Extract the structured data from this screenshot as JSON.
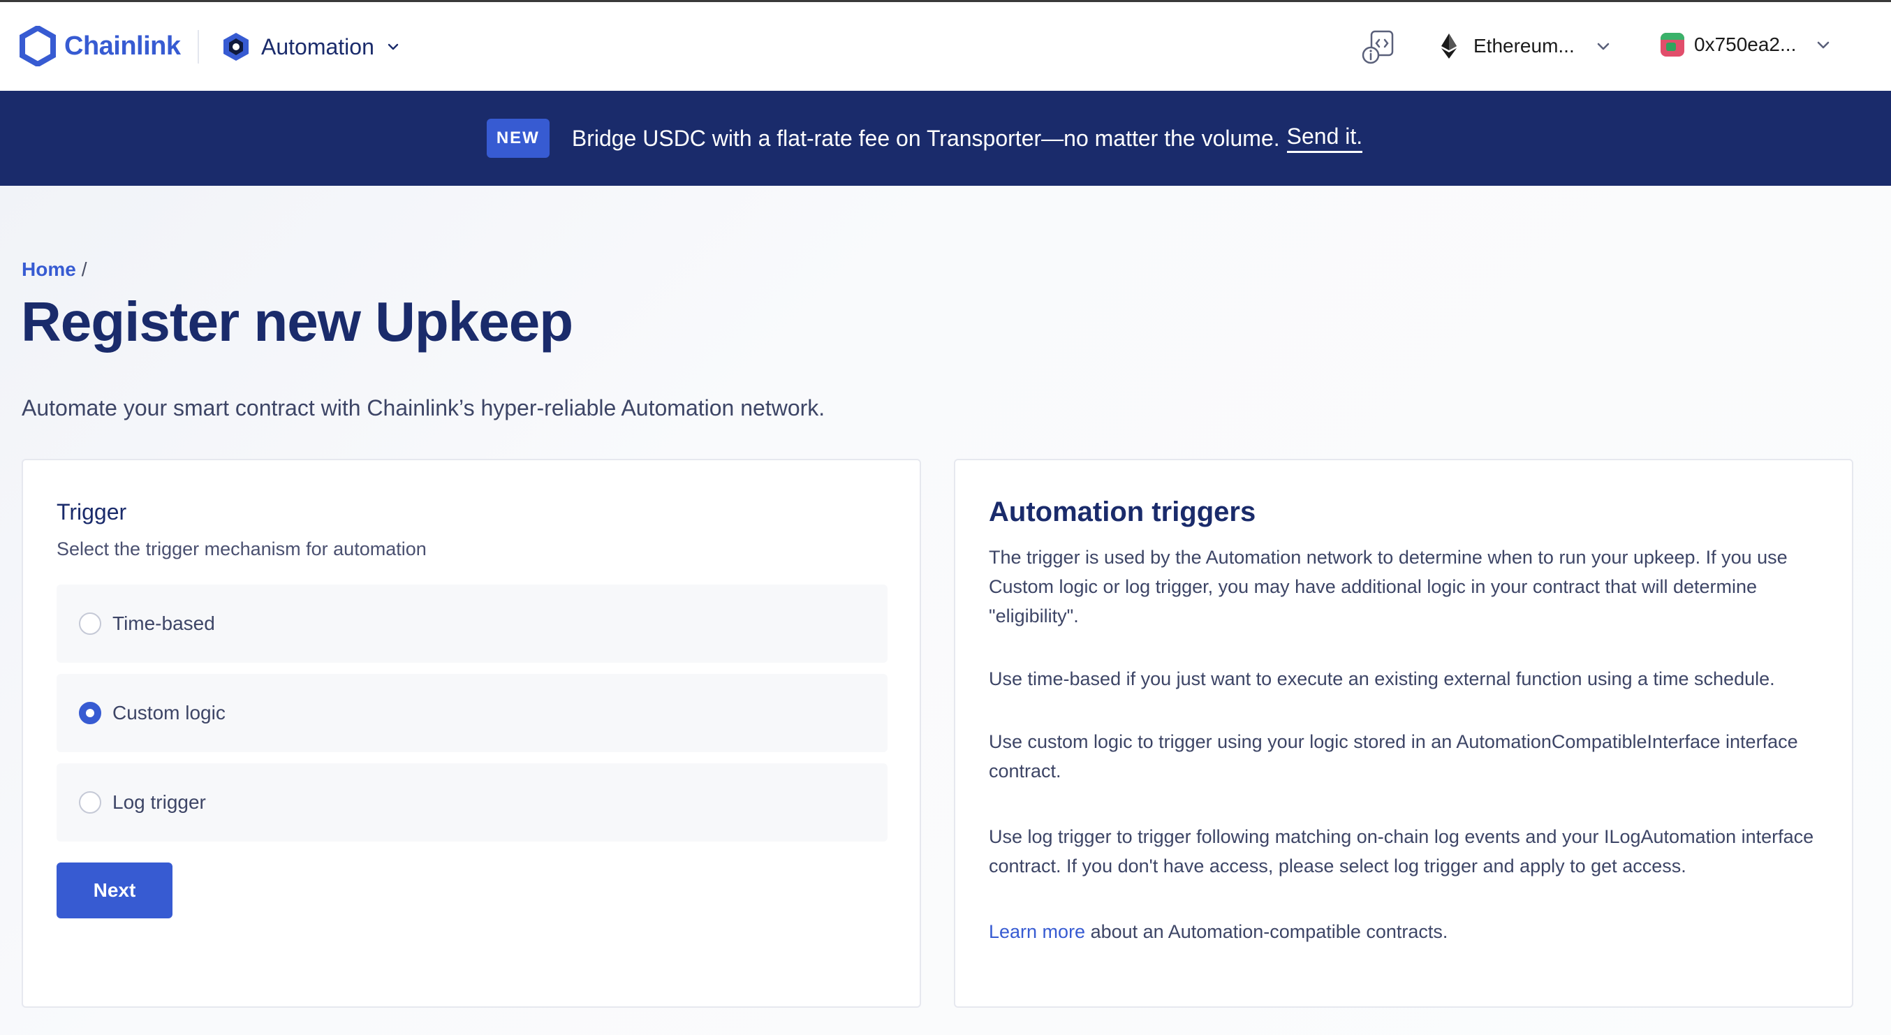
{
  "header": {
    "brand_name": "Chainlink",
    "product_name": "Automation",
    "network_label": "Ethereum...",
    "account_label": "0x750ea2..."
  },
  "banner": {
    "badge": "NEW",
    "text": "Bridge USDC with a flat-rate fee on Transporter—no matter the volume.",
    "link": "Send it."
  },
  "breadcrumb": {
    "home": "Home",
    "separator": "/"
  },
  "page": {
    "title": "Register new Upkeep",
    "subtitle": "Automate your smart contract with Chainlink’s hyper-reliable Automation network."
  },
  "trigger_form": {
    "title": "Trigger",
    "subtitle": "Select the trigger mechanism for automation",
    "options": [
      {
        "label": "Time-based",
        "selected": false
      },
      {
        "label": "Custom logic",
        "selected": true
      },
      {
        "label": "Log trigger",
        "selected": false
      }
    ],
    "next_label": "Next"
  },
  "info": {
    "title": "Automation triggers",
    "paragraphs": [
      "The trigger is used by the Automation network to determine when to run your upkeep. If you use Custom logic or log trigger, you may have additional logic in your contract that will determine \"eligibility\".",
      "Use time-based if you just want to execute an existing external function using a time schedule.",
      "Use custom logic to trigger using your logic stored in an AutomationCompatibleInterface interface contract.",
      "Use log trigger to trigger following matching on-chain log events and your ILogAutomation interface contract. If you don't have access, please select log trigger and apply to get access."
    ],
    "learn_more_link": "Learn more",
    "learn_more_rest": " about an Automation-compatible contracts."
  },
  "colors": {
    "brand_blue": "#375bd2",
    "navy": "#1a2b6b",
    "banner_bg": "#1a2b6b"
  },
  "icons": {
    "brand": "chainlink-hexagon-icon",
    "product": "automation-hexagon-icon",
    "dev": "developer-info-icon",
    "network": "ethereum-icon",
    "account": "wallet-avatar",
    "dropdown": "chevron-down-icon"
  }
}
